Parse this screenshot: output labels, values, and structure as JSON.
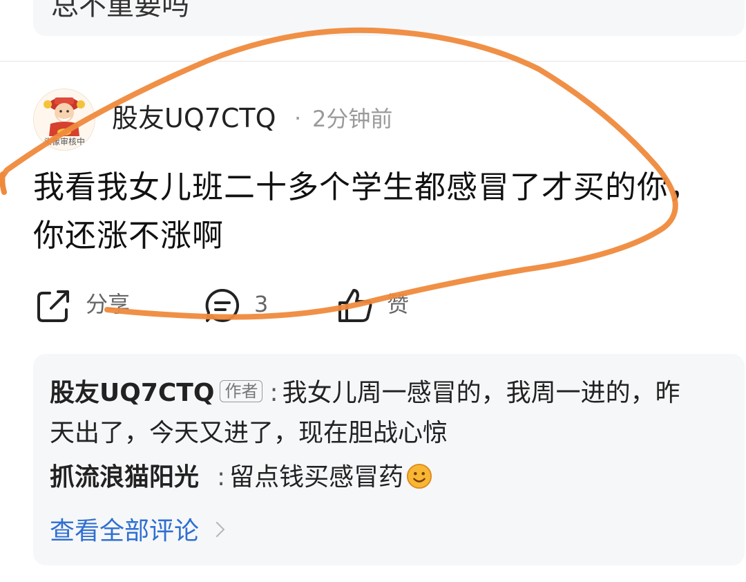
{
  "previous_post": {
    "text_fragment": "总不重要吗"
  },
  "post": {
    "avatar_caption": "头像审核中",
    "author": "股友UQ7CTQ",
    "separator": "·",
    "time": "2分钟前",
    "content": "我看我女儿班二十多个学生都感冒了才买的你，你还涨不涨啊"
  },
  "actions": {
    "share_label": "分享",
    "comment_count": "3",
    "like_label": "赞"
  },
  "replies": [
    {
      "author": "股友UQ7CTQ",
      "tag": "作者",
      "colon": ":",
      "text": "我女儿周一感冒的，我周一进的，昨天出了，今天又进了，现在胆战心惊"
    },
    {
      "author": "抓流浪猫阳光",
      "colon": ":",
      "text": "留点钱买感冒药"
    }
  ],
  "view_all_label": "查看全部评论",
  "annotation": {
    "stroke_color": "#ef8a3c"
  },
  "colors": {
    "link": "#2f6fd1",
    "meta": "#9a9a9a",
    "card_bg": "#f6f7f9"
  }
}
